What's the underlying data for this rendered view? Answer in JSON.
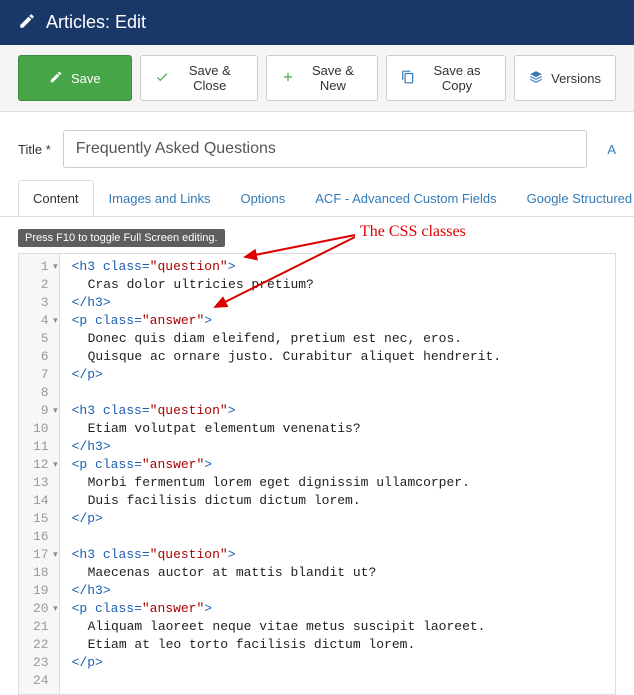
{
  "header": {
    "title": "Articles: Edit"
  },
  "toolbar": {
    "save": "Save",
    "save_close": "Save & Close",
    "save_new": "Save & New",
    "save_copy": "Save as Copy",
    "versions": "Versions"
  },
  "form": {
    "title_label": "Title *",
    "title_value": "Frequently Asked Questions",
    "alias": "A"
  },
  "tabs": {
    "content": "Content",
    "images": "Images and Links",
    "options": "Options",
    "acf": "ACF - Advanced Custom Fields",
    "gsd": "Google Structured D"
  },
  "editor": {
    "hint": "Press F10 to toggle Full Screen editing.",
    "annotation": "The CSS classes",
    "lines": [
      {
        "n": 1,
        "fold": true,
        "html": "<span class='punct'>&lt;</span><span class='tag'>h3</span> <span class='attr'>class</span><span class='punct'>=</span><span class='str'>\"question\"</span><span class='punct'>&gt;</span>"
      },
      {
        "n": 2,
        "html": "<span class='txt ind1'>Cras dolor ultricies pretium?</span>"
      },
      {
        "n": 3,
        "html": "<span class='punct'>&lt;/</span><span class='tag'>h3</span><span class='punct'>&gt;</span>"
      },
      {
        "n": 4,
        "fold": true,
        "html": "<span class='punct'>&lt;</span><span class='tag'>p</span> <span class='attr'>class</span><span class='punct'>=</span><span class='str'>\"answer\"</span><span class='punct'>&gt;</span>"
      },
      {
        "n": 5,
        "html": "<span class='txt ind1'>Donec quis diam eleifend, pretium est nec, eros.</span>"
      },
      {
        "n": 6,
        "html": "<span class='txt ind1'>Quisque ac ornare justo. Curabitur aliquet hendrerit.</span>"
      },
      {
        "n": 7,
        "html": "<span class='punct'>&lt;/</span><span class='tag'>p</span><span class='punct'>&gt;</span>"
      },
      {
        "n": 8,
        "html": ""
      },
      {
        "n": 9,
        "fold": true,
        "html": "<span class='punct'>&lt;</span><span class='tag'>h3</span> <span class='attr'>class</span><span class='punct'>=</span><span class='str'>\"question\"</span><span class='punct'>&gt;</span>"
      },
      {
        "n": 10,
        "html": "<span class='txt ind1'>Etiam volutpat elementum venenatis?</span>"
      },
      {
        "n": 11,
        "html": "<span class='punct'>&lt;/</span><span class='tag'>h3</span><span class='punct'>&gt;</span>"
      },
      {
        "n": 12,
        "fold": true,
        "html": "<span class='punct'>&lt;</span><span class='tag'>p</span> <span class='attr'>class</span><span class='punct'>=</span><span class='str'>\"answer\"</span><span class='punct'>&gt;</span>"
      },
      {
        "n": 13,
        "html": "<span class='txt ind1'>Morbi fermentum lorem eget dignissim ullamcorper.</span>"
      },
      {
        "n": 14,
        "html": "<span class='txt ind1'>Duis facilisis dictum dictum lorem.</span>"
      },
      {
        "n": 15,
        "html": "<span class='punct'>&lt;/</span><span class='tag'>p</span><span class='punct'>&gt;</span>"
      },
      {
        "n": 16,
        "html": ""
      },
      {
        "n": 17,
        "fold": true,
        "html": "<span class='punct'>&lt;</span><span class='tag'>h3</span> <span class='attr'>class</span><span class='punct'>=</span><span class='str'>\"question\"</span><span class='punct'>&gt;</span>"
      },
      {
        "n": 18,
        "html": "<span class='txt ind1'>Maecenas auctor at mattis blandit ut?</span>"
      },
      {
        "n": 19,
        "html": "<span class='punct'>&lt;/</span><span class='tag'>h3</span><span class='punct'>&gt;</span>"
      },
      {
        "n": 20,
        "fold": true,
        "html": "<span class='punct'>&lt;</span><span class='tag'>p</span> <span class='attr'>class</span><span class='punct'>=</span><span class='str'>\"answer\"</span><span class='punct'>&gt;</span>"
      },
      {
        "n": 21,
        "html": "<span class='txt ind1'>Aliquam laoreet neque vitae metus suscipit laoreet.</span>"
      },
      {
        "n": 22,
        "html": "<span class='txt ind1'>Etiam at leo torto facilisis dictum lorem.</span>"
      },
      {
        "n": 23,
        "html": "<span class='punct'>&lt;/</span><span class='tag'>p</span><span class='punct'>&gt;</span>"
      },
      {
        "n": 24,
        "html": ""
      }
    ]
  }
}
